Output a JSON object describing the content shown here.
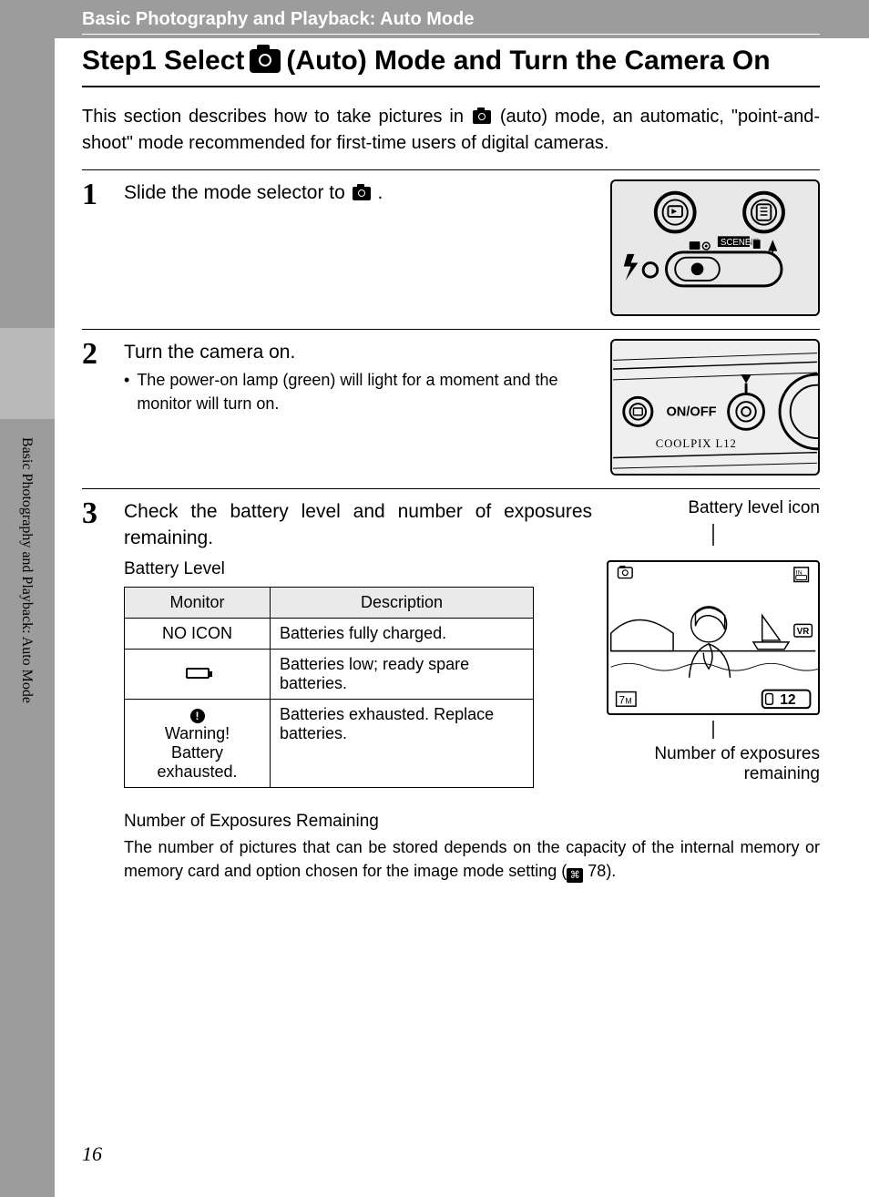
{
  "breadcrumb": "Basic Photography and Playback: Auto Mode",
  "side_label": "Basic Photography and Playback: Auto Mode",
  "title_parts": {
    "pre": "Step1 Select",
    "post": "(Auto) Mode and Turn the Camera On"
  },
  "intro_parts": {
    "pre": "This section describes how to take pictures in ",
    "post": " (auto) mode, an automatic, \"point-and-shoot\" mode recommended for first-time users of digital cameras."
  },
  "steps": [
    {
      "num": "1",
      "title_pre": "Slide the mode selector to ",
      "title_post": "."
    },
    {
      "num": "2",
      "title": "Turn the camera on.",
      "bullet": "The power-on lamp (green) will light for a moment and the monitor will turn on.",
      "illus_labels": {
        "onoff": "ON/OFF",
        "model": "COOLPIX L12"
      }
    },
    {
      "num": "3",
      "title": "Check the battery level and number of exposures remaining.",
      "battery_heading": "Battery Level",
      "table": {
        "headers": [
          "Monitor",
          "Description"
        ],
        "rows": [
          {
            "monitor_text": "NO ICON",
            "desc": "Batteries fully charged."
          },
          {
            "monitor_icon": "battery-low",
            "desc": "Batteries low; ready spare batteries."
          },
          {
            "monitor_icon": "warning",
            "monitor_lines": [
              "Warning!",
              "Battery",
              "exhausted."
            ],
            "desc": "Batteries exhausted. Replace batteries."
          }
        ]
      },
      "right_labels": {
        "top": "Battery level icon",
        "bottom1": "Number of exposures",
        "bottom2": "remaining",
        "lcd_count": "12",
        "lcd_mp": "7M"
      },
      "exposures_heading": "Number of Exposures Remaining",
      "exposures_para_pre": "The number of pictures that can be stored depends on the capacity of the internal memory or memory card and option chosen for the image mode setting (",
      "exposures_para_ref": "78",
      "exposures_para_post": ")."
    }
  ],
  "page_number": "16"
}
